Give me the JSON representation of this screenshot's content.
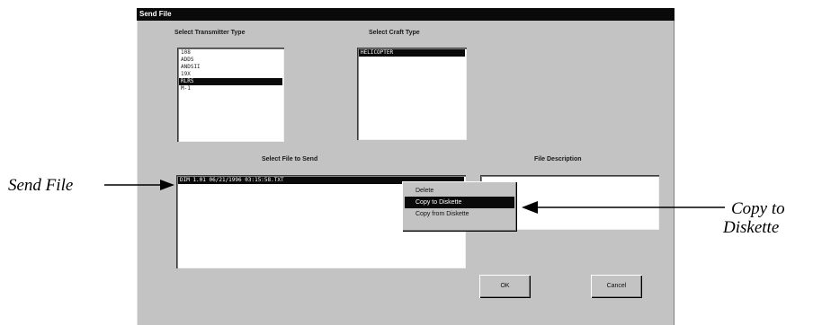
{
  "window": {
    "title": "Send File"
  },
  "transmitter": {
    "label": "Select Transmitter Type",
    "items": [
      "108",
      "ADDS",
      "ANDSII",
      "19X",
      "RLRS",
      "M-1"
    ],
    "selected_index": 4
  },
  "craft": {
    "label": "Select Craft Type",
    "items": [
      "HELICOPTER"
    ],
    "selected_index": 0
  },
  "file_select": {
    "label": "Select File to Send",
    "items": [
      "DIM         1.01 06/21/1996 03:15:58.TXT"
    ],
    "selected_index": 0
  },
  "file_description": {
    "label": "File Description",
    "value": ""
  },
  "context_menu": {
    "items": [
      "Delete",
      "Copy to Diskette",
      "Copy from Diskette"
    ],
    "highlighted_index": 1
  },
  "buttons": {
    "ok": "OK",
    "cancel": "Cancel"
  },
  "callouts": {
    "send_file": "Send File",
    "copy_to_diskette_line1": "Copy to",
    "copy_to_diskette_line2": "Diskette"
  },
  "colors": {
    "dialog_bg": "#c3c3c3",
    "titlebar_bg": "#0a0a0a",
    "selection_bg": "#0a0a0a",
    "list_bg": "#ffffff"
  }
}
